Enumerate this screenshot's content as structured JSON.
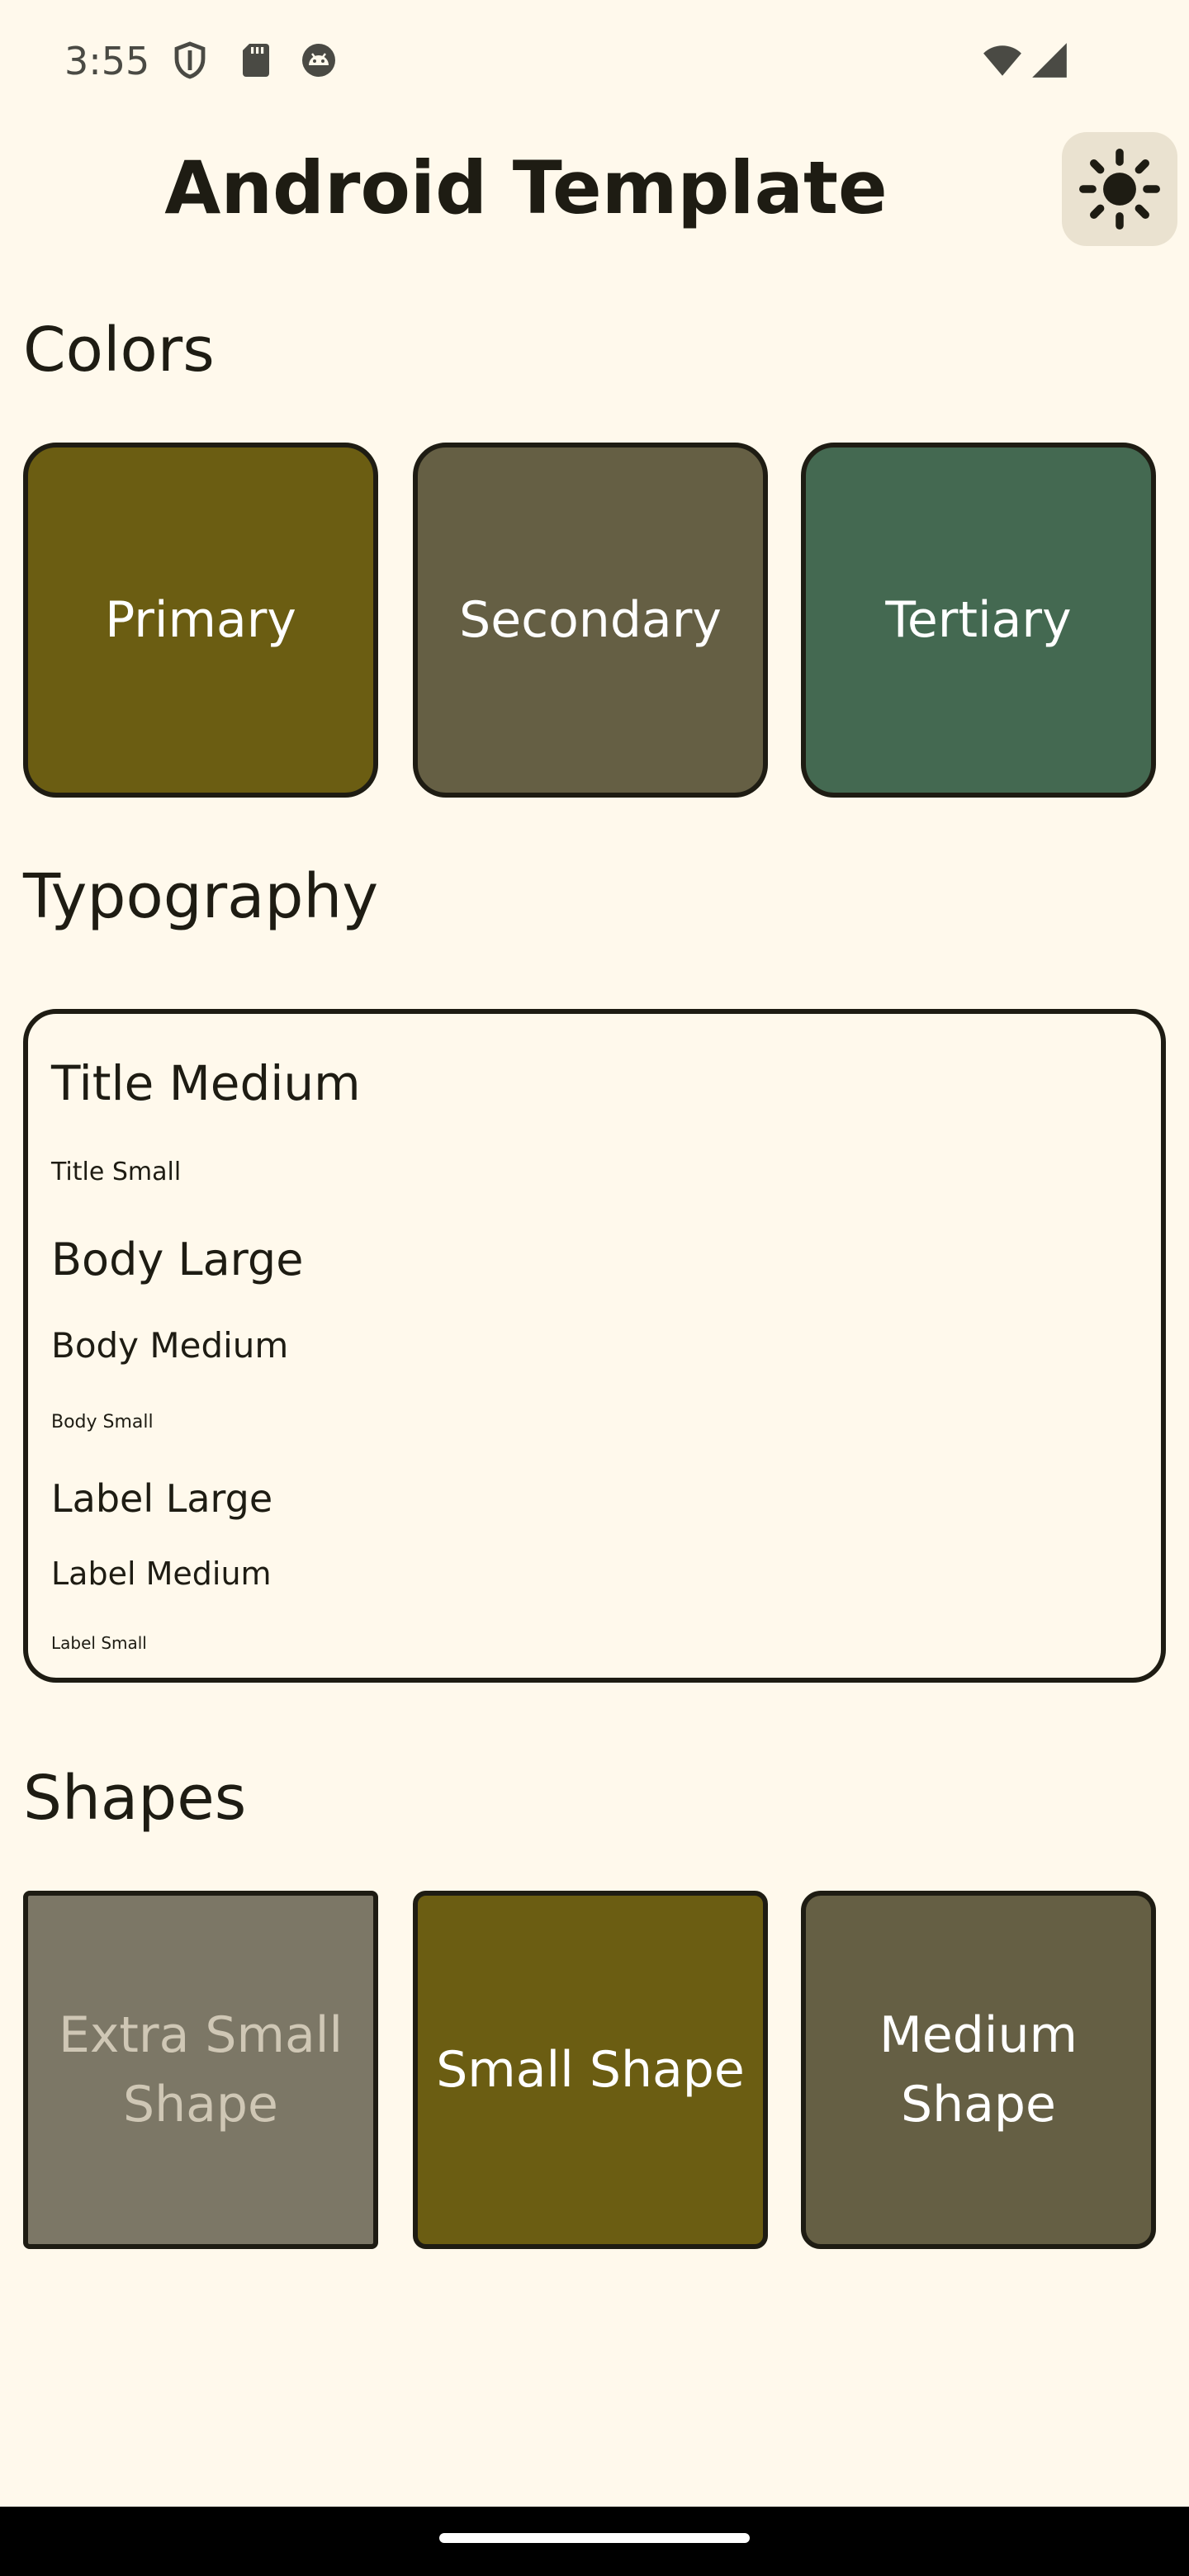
{
  "status_bar": {
    "time": "3:55",
    "icons": [
      "shield-icon",
      "sd-card-icon",
      "android-robot-icon",
      "wifi-icon",
      "cellular-signal-icon"
    ]
  },
  "header": {
    "title": "Android Template",
    "theme_toggle_icon": "sun-icon"
  },
  "sections": {
    "colors": "Colors",
    "typography": "Typography",
    "shapes": "Shapes"
  },
  "colors": {
    "primary": {
      "label": "Primary",
      "hex": "#6B5D12"
    },
    "secondary": {
      "label": "Secondary",
      "hex": "#655F44"
    },
    "tertiary": {
      "label": "Tertiary",
      "hex": "#446951"
    }
  },
  "typography": {
    "title_medium": "Title Medium",
    "title_small": "Title Small",
    "body_large": "Body Large",
    "body_medium": "Body Medium",
    "body_small": "Body Small",
    "label_large": "Label Large",
    "label_medium": "Label Medium",
    "label_small": "Label Small"
  },
  "shapes": {
    "extra_small": {
      "label": "Extra Small Shape",
      "hex": "#7C7766"
    },
    "small": {
      "label": "Small Shape",
      "hex": "#6B5D12"
    },
    "medium": {
      "label": "Medium Shape",
      "hex": "#655F44"
    }
  },
  "theme": {
    "background": "#FFF9EC",
    "on_background": "#1E1C13",
    "toggle_background": "#EAE2D0"
  }
}
